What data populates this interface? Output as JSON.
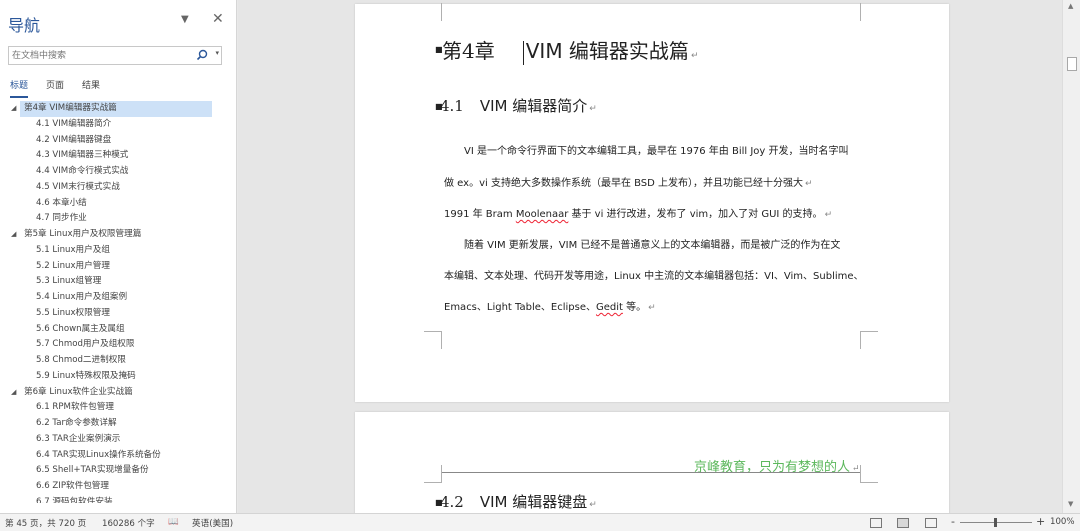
{
  "nav": {
    "title": "导航",
    "search_placeholder": "在文档中搜索",
    "tabs": [
      "标题",
      "页面",
      "结果"
    ],
    "items": [
      {
        "level": 0,
        "label": "第4章  VIM编辑器实战篇",
        "selected": true
      },
      {
        "level": 1,
        "label": "4.1  VIM编辑器简介"
      },
      {
        "level": 1,
        "label": "4.2  VIM编辑器键盘"
      },
      {
        "level": 1,
        "label": "4.3  VIM编辑器三种模式"
      },
      {
        "level": 1,
        "label": "4.4  VIM命令行模式实战"
      },
      {
        "level": 1,
        "label": "4.5  VIM末行模式实战"
      },
      {
        "level": 1,
        "label": "4.6  本章小结"
      },
      {
        "level": 1,
        "label": "4.7  同步作业"
      },
      {
        "level": 0,
        "label": "第5章  Linux用户及权限管理篇"
      },
      {
        "level": 1,
        "label": "5.1  Linux用户及组"
      },
      {
        "level": 1,
        "label": "5.2  Linux用户管理"
      },
      {
        "level": 1,
        "label": "5.3  Linux组管理"
      },
      {
        "level": 1,
        "label": "5.4  Linux用户及组案例"
      },
      {
        "level": 1,
        "label": "5.5  Linux权限管理"
      },
      {
        "level": 1,
        "label": "5.6  Chown属主及属组"
      },
      {
        "level": 1,
        "label": "5.7  Chmod用户及组权限"
      },
      {
        "level": 1,
        "label": "5.8  Chmod二进制权限"
      },
      {
        "level": 1,
        "label": "5.9  Linux特殊权限及掩码"
      },
      {
        "level": 0,
        "label": "第6章  Linux软件企业实战篇"
      },
      {
        "level": 1,
        "label": "6.1  RPM软件包管理"
      },
      {
        "level": 1,
        "label": "6.2  Tar命令参数详解"
      },
      {
        "level": 1,
        "label": "6.3  TAR企业案例演示"
      },
      {
        "level": 1,
        "label": "6.4  TAR实现Linux操作系统备份"
      },
      {
        "level": 1,
        "label": "6.5  Shell+TAR实现增量备份"
      },
      {
        "level": 1,
        "label": "6.6  ZIP软件包管理"
      },
      {
        "level": 1,
        "label": "6.7  源码包软件安装"
      }
    ]
  },
  "doc": {
    "chapter_num": "第4章",
    "chapter_title": "VIM 编辑器实战篇",
    "sec1_num": "4.1",
    "sec1_title": "VIM 编辑器简介",
    "para1_line1": "VI 是一个命令行界面下的文本编辑工具，最早在 1976 年由 Bill Joy 开发，当时名字叫",
    "para1_line2": "做 ex。vi 支持绝大多数操作系统（最早在 BSD 上发布），并且功能已经十分强大",
    "para2_pre": "1991 年 Bram ",
    "para2_sq": "Moolenaar",
    "para2_post": " 基于 vi 进行改进，发布了 vim，加入了对 GUI 的支持。",
    "para3_line1": "随着 VIM 更新发展，VIM 已经不是普通意义上的文本编辑器，而是被广泛的作为在文",
    "para3_line2": "本编辑、文本处理、代码开发等用途，Linux 中主流的文本编辑器包括：VI、Vim、Sublime、",
    "para3_line3_pre": "Emacs、Light Table、Eclipse、",
    "para3_line3_sq": "Gedit",
    "para3_line3_post": " 等。",
    "para_mark": "↵",
    "page2_header": "京峰教育，只为有梦想的人",
    "sec2_num": "4.2",
    "sec2_title": "VIM 编辑器键盘"
  },
  "status": {
    "page": "第 45 页，共 720 页",
    "words": "160286 个字",
    "language": "英语(美国)",
    "zoom_minus": "-",
    "zoom_plus": "+",
    "zoom": "100%"
  },
  "colors": {
    "accent": "#2b579a",
    "header_green": "#5cb85c",
    "selection": "#cde1f7"
  }
}
